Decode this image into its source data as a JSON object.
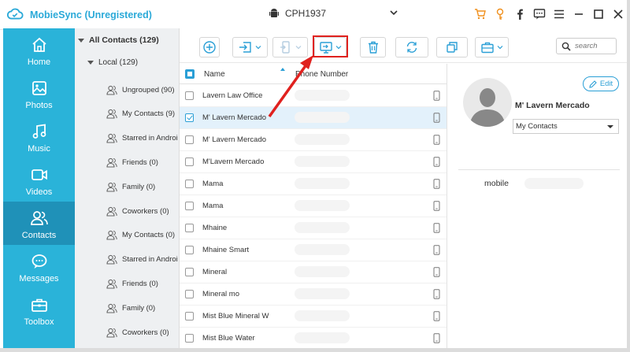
{
  "app": {
    "title": "MobieSync (Unregistered)",
    "device": "CPH1937"
  },
  "titlebar_icons": [
    "cart-icon",
    "key-icon",
    "facebook-icon",
    "feedback-icon",
    "menu-icon",
    "minimize-icon",
    "maximize-icon",
    "close-icon"
  ],
  "nav": [
    {
      "label": "Home",
      "icon": "home-icon"
    },
    {
      "label": "Photos",
      "icon": "photo-icon"
    },
    {
      "label": "Music",
      "icon": "music-icon"
    },
    {
      "label": "Videos",
      "icon": "video-icon"
    },
    {
      "label": "Contacts",
      "icon": "contacts-icon",
      "active": true
    },
    {
      "label": "Messages",
      "icon": "message-icon"
    },
    {
      "label": "Toolbox",
      "icon": "toolbox-icon"
    }
  ],
  "tree": {
    "root": "All Contacts  (129)",
    "local": "Local  (129)",
    "groups": [
      "Ungrouped  (90)",
      "My Contacts  (9)",
      "Starred in Androi",
      "Friends  (0)",
      "Family  (0)",
      "Coworkers  (0)",
      "My Contacts  (0)",
      "Starred in Androi",
      "Friends  (0)",
      "Family  (0)",
      "Coworkers  (0)"
    ]
  },
  "toolbar": {
    "buttons": [
      "add-button",
      "import-button",
      "export-to-device-button",
      "export-to-pc-button",
      "delete-button",
      "refresh-button",
      "duplicate-button",
      "toolbox-button"
    ],
    "search_placeholder": "search"
  },
  "table": {
    "col_name": "Name",
    "col_phone": "Phone Number",
    "rows": [
      {
        "name": "Lavern Law Office",
        "selected": false
      },
      {
        "name": "M' Lavern Mercado",
        "selected": true
      },
      {
        "name": "M' Lavern Mercado",
        "selected": false
      },
      {
        "name": "M'Lavern Mercado",
        "selected": false
      },
      {
        "name": "Mama",
        "selected": false
      },
      {
        "name": "Mama",
        "selected": false
      },
      {
        "name": "Mhaine",
        "selected": false
      },
      {
        "name": "Mhaine Smart",
        "selected": false
      },
      {
        "name": "Mineral",
        "selected": false
      },
      {
        "name": "Mineral mo",
        "selected": false
      },
      {
        "name": "Mist Blue Mineral W",
        "selected": false
      },
      {
        "name": "Mist Blue Water",
        "selected": false
      }
    ]
  },
  "detail": {
    "edit_label": "Edit",
    "name": "M' Lavern Mercado",
    "group": "My Contacts",
    "phone_label": "mobile"
  },
  "colors": {
    "accent": "#2ab3d9",
    "nav_active": "#1f91b8",
    "highlight": "#e0211e"
  }
}
